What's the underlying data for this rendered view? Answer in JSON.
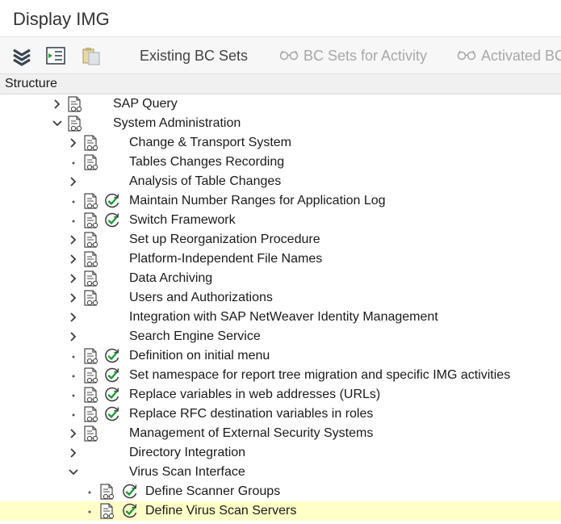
{
  "window": {
    "title": "Display IMG"
  },
  "toolbar": {
    "icons": [
      "collapse-all-icon",
      "expand-subtree-icon",
      "paste-clipboard-icon"
    ],
    "existing_bc_sets": "Existing BC Sets",
    "bc_sets_for_activity": "BC Sets for Activity",
    "activated_bc_sets": "Activated BC"
  },
  "structure": {
    "header": "Structure"
  },
  "colors": {
    "accent_selected_row": "#ffffc8",
    "execute_icon_green": "#1f9a3a",
    "disabled_text": "#a8a8a8"
  },
  "tree": {
    "rows": [
      {
        "label": "SAP Query",
        "level": 0,
        "expander": "collapsed",
        "doc": true,
        "exec": false
      },
      {
        "label": "System Administration",
        "level": 0,
        "expander": "expanded",
        "doc": true,
        "exec": false
      },
      {
        "label": "Change & Transport System",
        "level": 1,
        "expander": "collapsed",
        "doc": true,
        "exec": false
      },
      {
        "label": "Tables Changes Recording",
        "level": 1,
        "expander": "leaf",
        "doc": true,
        "exec": false
      },
      {
        "label": "Analysis of Table Changes",
        "level": 1,
        "expander": "collapsed",
        "doc": false,
        "exec": false
      },
      {
        "label": "Maintain Number Ranges for Application Log",
        "level": 1,
        "expander": "leaf",
        "doc": true,
        "exec": true
      },
      {
        "label": "Switch Framework",
        "level": 1,
        "expander": "leaf",
        "doc": true,
        "exec": true
      },
      {
        "label": "Set up Reorganization Procedure",
        "level": 1,
        "expander": "collapsed",
        "doc": true,
        "exec": false
      },
      {
        "label": "Platform-Independent File Names",
        "level": 1,
        "expander": "collapsed",
        "doc": true,
        "exec": false
      },
      {
        "label": "Data Archiving",
        "level": 1,
        "expander": "collapsed",
        "doc": true,
        "exec": false
      },
      {
        "label": "Users and Authorizations",
        "level": 1,
        "expander": "collapsed",
        "doc": true,
        "exec": false
      },
      {
        "label": "Integration with SAP NetWeaver Identity Management",
        "level": 1,
        "expander": "collapsed",
        "doc": false,
        "exec": false
      },
      {
        "label": "Search Engine Service",
        "level": 1,
        "expander": "collapsed",
        "doc": false,
        "exec": false
      },
      {
        "label": "Definition on initial menu",
        "level": 1,
        "expander": "leaf",
        "doc": true,
        "exec": true
      },
      {
        "label": "Set namespace for report tree migration and specific IMG activities",
        "level": 1,
        "expander": "leaf",
        "doc": true,
        "exec": true
      },
      {
        "label": "Replace variables in web addresses (URLs)",
        "level": 1,
        "expander": "leaf",
        "doc": true,
        "exec": true
      },
      {
        "label": "Replace RFC destination variables in roles",
        "level": 1,
        "expander": "leaf",
        "doc": true,
        "exec": true
      },
      {
        "label": "Management of External Security Systems",
        "level": 1,
        "expander": "collapsed",
        "doc": true,
        "exec": false
      },
      {
        "label": "Directory Integration",
        "level": 1,
        "expander": "collapsed",
        "doc": false,
        "exec": false
      },
      {
        "label": "Virus Scan Interface",
        "level": 1,
        "expander": "expanded",
        "doc": false,
        "exec": false
      },
      {
        "label": "Define Scanner Groups",
        "level": 2,
        "expander": "leaf",
        "doc": true,
        "exec": true
      },
      {
        "label": "Define Virus Scan Servers",
        "level": 2,
        "expander": "leaf",
        "doc": true,
        "exec": true,
        "selected": true
      }
    ]
  }
}
